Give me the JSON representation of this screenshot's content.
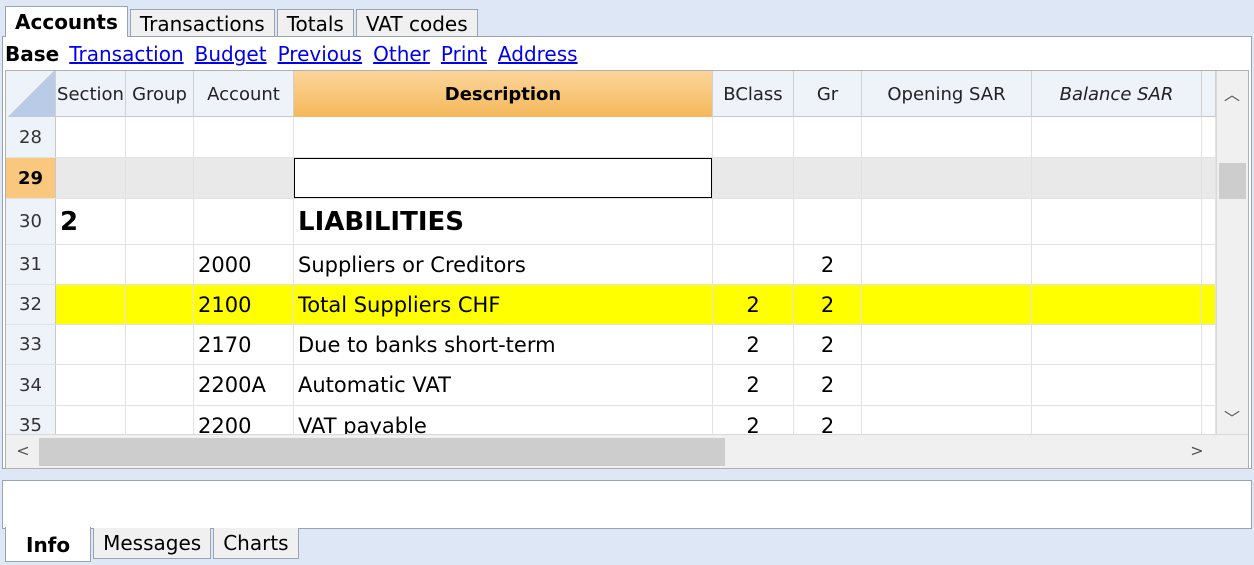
{
  "top_tabs": [
    "Accounts",
    "Transactions",
    "Totals",
    "VAT codes"
  ],
  "views": {
    "active": "Base",
    "links": [
      "Transaction",
      "Budget",
      "Previous",
      "Other",
      "Print",
      "Address"
    ]
  },
  "columns": [
    "Section",
    "Group",
    "Account",
    "Description",
    "BClass",
    "Gr",
    "Opening SAR",
    "Balance SAR"
  ],
  "rows": [
    {
      "n": "28",
      "section": "",
      "group": "",
      "account": "",
      "description": "",
      "bclass": "",
      "gr": "",
      "opening": "",
      "balance": ""
    },
    {
      "n": "29",
      "section": "",
      "group": "",
      "account": "",
      "description": "",
      "bclass": "",
      "gr": "",
      "opening": "",
      "balance": ""
    },
    {
      "n": "30",
      "section": "2",
      "group": "",
      "account": "",
      "description": "LIABILITIES",
      "bclass": "",
      "gr": "",
      "opening": "",
      "balance": ""
    },
    {
      "n": "31",
      "section": "",
      "group": "",
      "account": "2000",
      "description": "Suppliers or Creditors",
      "bclass": "",
      "gr": "2",
      "opening": "",
      "balance": ""
    },
    {
      "n": "32",
      "section": "",
      "group": "",
      "account": "2100",
      "description": "Total Suppliers CHF",
      "bclass": "2",
      "gr": "2",
      "opening": "",
      "balance": ""
    },
    {
      "n": "33",
      "section": "",
      "group": "",
      "account": "2170",
      "description": "Due to banks short-term",
      "bclass": "2",
      "gr": "2",
      "opening": "",
      "balance": ""
    },
    {
      "n": "34",
      "section": "",
      "group": "",
      "account": "2200A",
      "description": "Automatic VAT",
      "bclass": "2",
      "gr": "2",
      "opening": "",
      "balance": ""
    },
    {
      "n": "35",
      "section": "",
      "group": "",
      "account": "2200",
      "description": "VAT payable",
      "bclass": "2",
      "gr": "2",
      "opening": "",
      "balance": ""
    }
  ],
  "bottom_tabs": [
    "Info",
    "Messages",
    "Charts"
  ],
  "colors": {
    "highlight_row": "#ffff00",
    "selected_rownum": "#f9c77e",
    "active_header": "#f5b85a",
    "link": "#0000ee"
  },
  "icons": {
    "scroll_up": "chevron-up-icon",
    "scroll_down": "chevron-down-icon",
    "scroll_left": "chevron-left-icon",
    "scroll_right": "chevron-right-icon"
  }
}
